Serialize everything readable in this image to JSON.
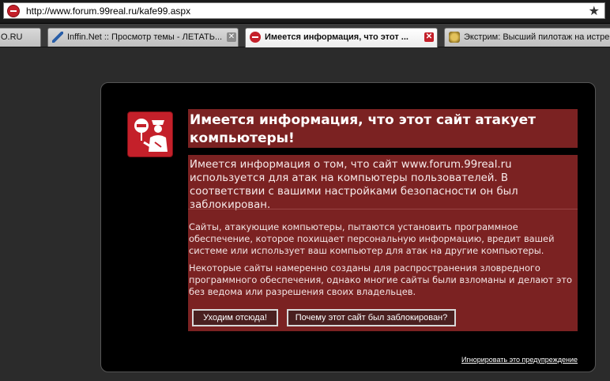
{
  "address_bar": {
    "url": "http://www.forum.99real.ru/kafe99.aspx",
    "site_icon": "blocked-site-icon",
    "bookmark_icon": "star-icon"
  },
  "tabs": [
    {
      "label": "O.RU",
      "icon": "",
      "active": false
    },
    {
      "label": "Inffin.Net :: Просмотр темы - ЛЕТАТЬ...",
      "icon": "pen-icon",
      "active": false
    },
    {
      "label": "Имеется информация, что этот ...",
      "icon": "blocked-site-icon",
      "active": true
    },
    {
      "label": "Экстрим: Высший пилотаж на истреб",
      "icon": "gold-icon",
      "active": false
    }
  ],
  "warning": {
    "title": "Имеется информация, что этот сайт атакует компьютеры!",
    "intro": "Имеется информация о том, что сайт www.forum.99real.ru используется для атак на компьютеры пользователей. В соответствии с вашими настройками безопасности он был заблокирован.",
    "paragraph1": "Сайты, атакующие компьютеры, пытаются установить программное обеспечение, которое похищает персональную информацию, вредит вашей системе или использует ваш компьютер для атак на другие компьютеры.",
    "paragraph2": "Некоторые сайты намеренно созданы для распространения зловредного программного обеспечения, однако многие сайты были взломаны и делают это без ведома или разрешения своих владельцев.",
    "leave_button": "Уходим отсюда!",
    "why_button": "Почему этот сайт был заблокирован?",
    "ignore_link": "Игнорировать это предупреждение",
    "icon": "police-officer-icon",
    "colors": {
      "panel": "#7b2222",
      "box": "#000000",
      "accent": "#c4202a"
    }
  }
}
